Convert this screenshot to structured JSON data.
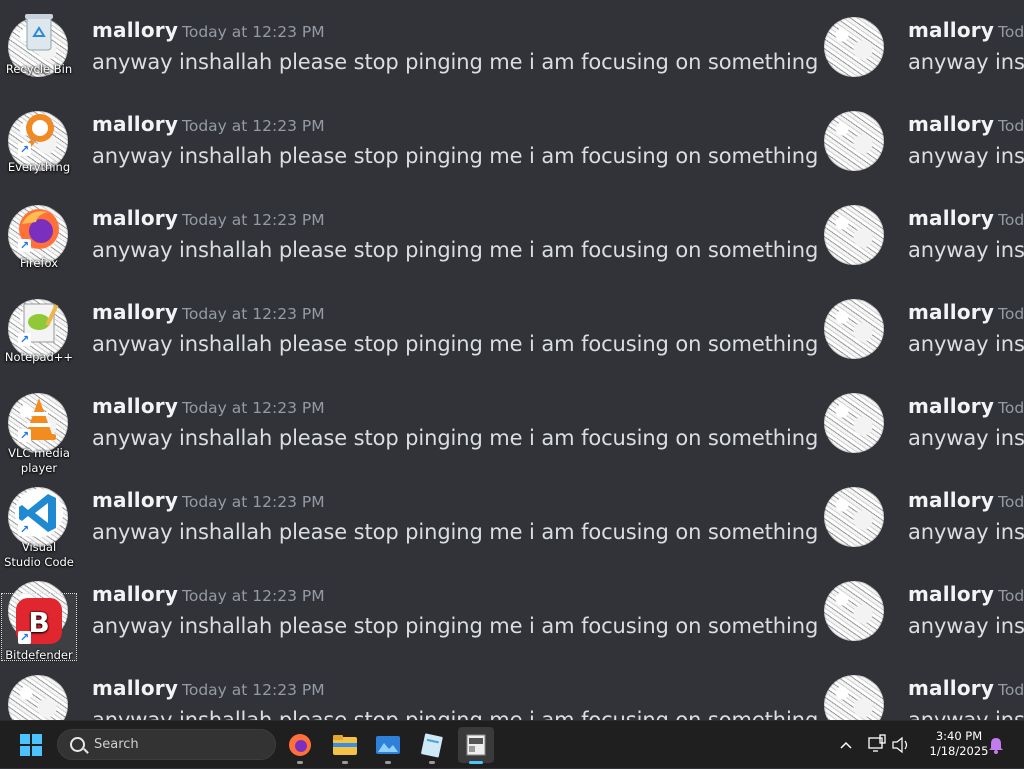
{
  "chat": {
    "username": "mallory",
    "timestamp": "Today at 12:23 PM",
    "message": "anyway inshallah please stop pinging me i am focusing on something",
    "timestamp_clipped": "Tod",
    "message_clipped": "anyway insh",
    "colors": {
      "background": "#313338",
      "username": "#f2f3f5",
      "timestamp": "#949ba4",
      "text": "#dbdee1"
    }
  },
  "desktop_icons": [
    {
      "label": "Recycle Bin",
      "icon": "recycle-bin-icon"
    },
    {
      "label": "Everything",
      "icon": "everything-search-icon"
    },
    {
      "label": "Firefox",
      "icon": "firefox-icon"
    },
    {
      "label": "Notepad++",
      "icon": "notepad-plus-plus-icon"
    },
    {
      "label": "VLC media player",
      "icon": "vlc-cone-icon"
    },
    {
      "label": "Visual Studio Code",
      "icon": "vscode-icon"
    },
    {
      "label": "Bitdefender",
      "icon": "bitdefender-icon"
    }
  ],
  "taskbar": {
    "search_placeholder": "Search",
    "apps": [
      "firefox-icon",
      "file-explorer-icon",
      "photos-icon",
      "notepad-icon",
      "discord-window-icon"
    ],
    "time": "3:40 PM",
    "date": "1/18/2025",
    "accent": "#4cc2ff"
  }
}
